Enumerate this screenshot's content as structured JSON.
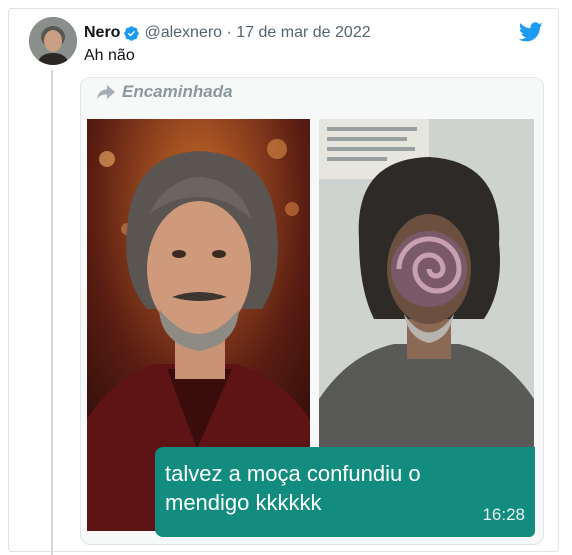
{
  "tweet": {
    "author_name": "Nero",
    "handle_date": "@alexnero · 17 de mar de 2022",
    "text": "Ah não"
  },
  "forwarded_label": "Encaminhada",
  "message": {
    "text": "talvez a moça confundiu o mendigo  kkkkkk",
    "time": "16:28"
  },
  "icons": {
    "verified": "verified-badge-icon",
    "brand": "twitter-bird-icon",
    "forward": "forward-arrow-icon"
  },
  "colors": {
    "brand_blue": "#1d9bf0",
    "whatsapp_bubble": "#128c7e"
  }
}
